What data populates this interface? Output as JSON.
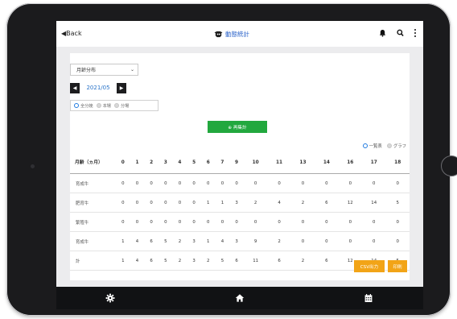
{
  "header": {
    "back_label": "◀Back",
    "brand_name": "動態統計"
  },
  "filters": {
    "period_select": "月齢分布",
    "month": "2021/05",
    "radios": [
      "全分娩",
      "本場",
      "分場"
    ],
    "selected_radio": "全分娩"
  },
  "recalc_label": "⊕ 再集計",
  "view_toggle": {
    "options": [
      "一覧表",
      "グラフ"
    ],
    "selected": "一覧表"
  },
  "table": {
    "header_label": "月齢（ヵ月）",
    "columns": [
      "0",
      "1",
      "2",
      "3",
      "4",
      "5",
      "6",
      "7",
      "9",
      "10",
      "11",
      "13",
      "14",
      "16",
      "17",
      "18"
    ],
    "rows": [
      {
        "label": "育成牛",
        "values": [
          "0",
          "0",
          "0",
          "0",
          "0",
          "0",
          "0",
          "0",
          "0",
          "0",
          "0",
          "0",
          "0",
          "0",
          "0",
          "0"
        ]
      },
      {
        "label": "肥育牛",
        "values": [
          "0",
          "0",
          "0",
          "0",
          "0",
          "0",
          "1",
          "1",
          "3",
          "2",
          "4",
          "2",
          "6",
          "12",
          "14",
          "5"
        ]
      },
      {
        "label": "繁殖牛",
        "values": [
          "0",
          "0",
          "0",
          "0",
          "0",
          "0",
          "0",
          "0",
          "0",
          "0",
          "0",
          "0",
          "0",
          "0",
          "0",
          "0"
        ]
      },
      {
        "label": "育成牛",
        "values": [
          "1",
          "4",
          "6",
          "5",
          "2",
          "3",
          "1",
          "4",
          "3",
          "9",
          "2",
          "0",
          "0",
          "0",
          "0",
          "0"
        ]
      },
      {
        "label": "計",
        "values": [
          "1",
          "4",
          "6",
          "5",
          "2",
          "3",
          "2",
          "5",
          "6",
          "11",
          "6",
          "2",
          "6",
          "12",
          "14",
          "5"
        ]
      }
    ]
  },
  "actions": {
    "csv_label": "CSV出力",
    "print_label": "印刷"
  },
  "colors": {
    "accent_blue": "#2a74c9",
    "green": "#22a83e",
    "orange": "#f2a417",
    "bar": "#111214"
  },
  "bottom_nav_icons": [
    "gear-icon",
    "home-icon",
    "calendar-icon"
  ]
}
